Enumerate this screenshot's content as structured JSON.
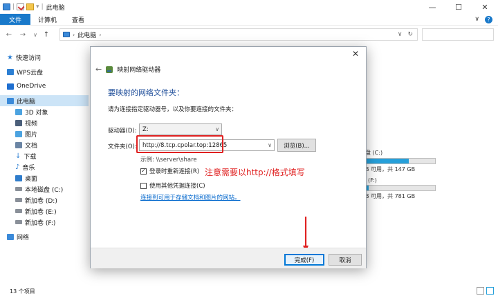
{
  "window": {
    "title": "此电脑"
  },
  "ribbon": {
    "tabs": [
      "文件",
      "计算机",
      "查看"
    ],
    "help": "?"
  },
  "nav": {
    "back": "←",
    "forward": "→",
    "recent": "∨",
    "up": "↑"
  },
  "address": {
    "location": "此电脑"
  },
  "sidebar": {
    "items": [
      {
        "label": "快速访问",
        "icon": "star-icon",
        "section": true
      },
      {
        "label": "WPS云盘",
        "icon": "cloud-icon",
        "section": true
      },
      {
        "label": "OneDrive",
        "icon": "cloud-icon",
        "section": true
      },
      {
        "label": "此电脑",
        "icon": "computer-icon",
        "section": true,
        "selected": true
      },
      {
        "label": "3D 对象",
        "icon": "cube-icon"
      },
      {
        "label": "视频",
        "icon": "video-icon"
      },
      {
        "label": "图片",
        "icon": "picture-icon"
      },
      {
        "label": "文档",
        "icon": "document-icon"
      },
      {
        "label": "下载",
        "icon": "download-icon"
      },
      {
        "label": "音乐",
        "icon": "music-icon"
      },
      {
        "label": "桌面",
        "icon": "desktop-icon"
      },
      {
        "label": "本地磁盘 (C:)",
        "icon": "drive-icon"
      },
      {
        "label": "新加卷 (D:)",
        "icon": "drive-icon"
      },
      {
        "label": "新加卷 (E:)",
        "icon": "drive-icon"
      },
      {
        "label": "新加卷 (F:)",
        "icon": "drive-icon"
      },
      {
        "label": "网络",
        "icon": "network-icon",
        "section": true
      }
    ]
  },
  "drives": [
    {
      "name": "盘 (C:)",
      "usage": "B 可用，共 147 GB",
      "used_fraction": 0.62
    },
    {
      "name": "(F:)",
      "usage": "B 可用，共 781 GB",
      "used_fraction": 0.04
    }
  ],
  "status": {
    "count": "13 个项目"
  },
  "dialog": {
    "title": "映射网络驱动器",
    "heading": "要映射的网络文件夹：",
    "instruction": "请为连接指定驱动器号，以及你要连接的文件夹：",
    "drive_label": "驱动器(D):",
    "drive_value": "Z:",
    "folder_label": "文件夹(O):",
    "folder_value": "http://8.tcp.cpolar.top:12865",
    "browse": "浏览(B)...",
    "example": "示例: \\\\server\\share",
    "reconnect_label": "登录时重新连接(R)",
    "reconnect_checked": true,
    "other_creds_label": "使用其他凭据连接(C)",
    "other_creds_checked": false,
    "link": "连接到可用于存储文档和图片的网站。",
    "annotation": "注意需要以http://格式填写",
    "finish": "完成(F)",
    "cancel": "取消"
  },
  "colors": {
    "accent": "#1979ca",
    "annotation": "#e02020",
    "heading": "#1f4e9a"
  }
}
